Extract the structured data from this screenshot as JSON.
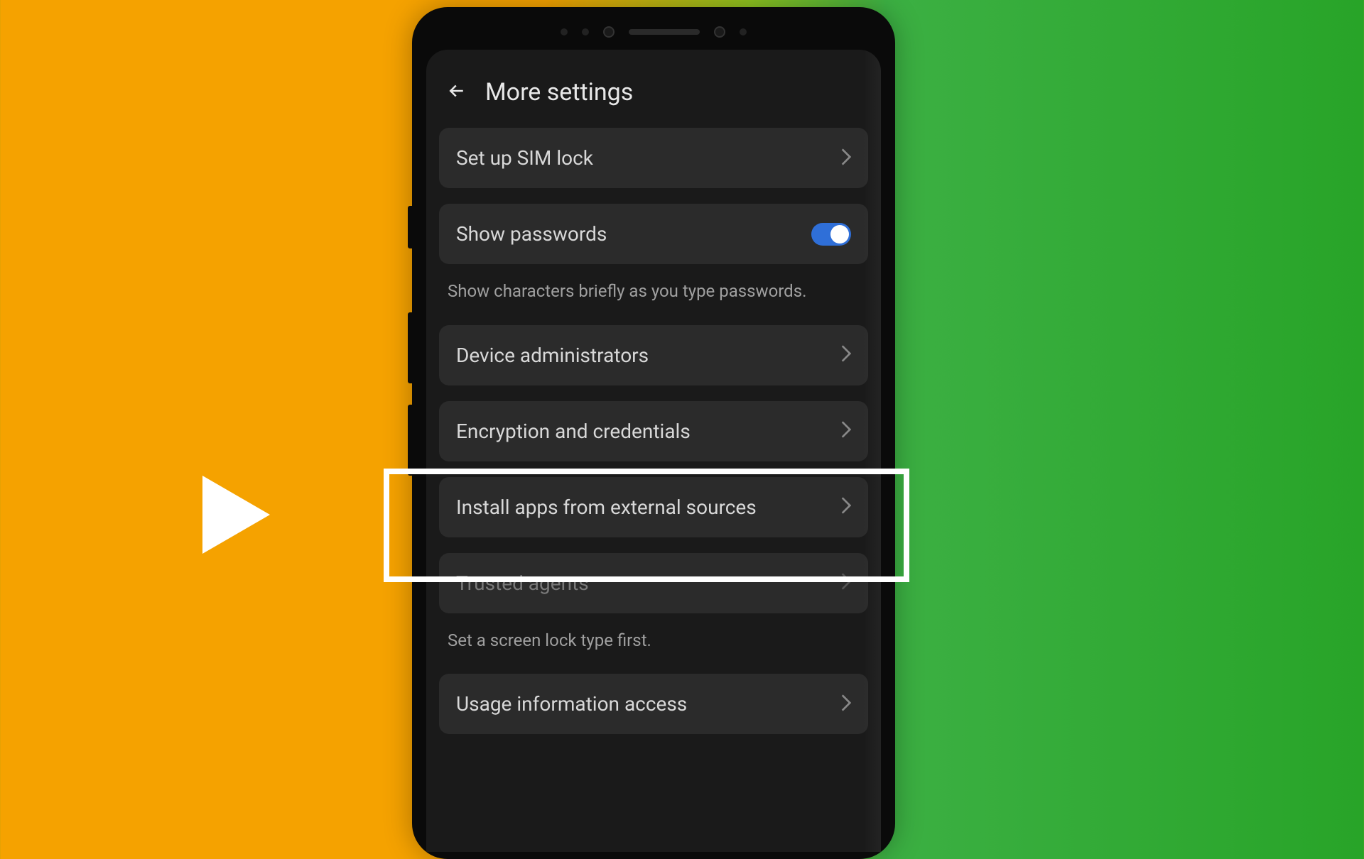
{
  "header": {
    "title": "More settings"
  },
  "items": {
    "sim_lock": {
      "label": "Set up SIM lock"
    },
    "show_passwords": {
      "label": "Show passwords",
      "description": "Show characters briefly as you type passwords."
    },
    "device_admins": {
      "label": "Device administrators"
    },
    "encryption": {
      "label": "Encryption and credentials"
    },
    "install_external": {
      "label": "Install apps from external sources"
    },
    "trusted_agents": {
      "label": "Trusted agents",
      "description": "Set a screen lock type first."
    },
    "usage_info": {
      "label": "Usage information access"
    }
  },
  "toggle_state": {
    "show_passwords": true
  }
}
